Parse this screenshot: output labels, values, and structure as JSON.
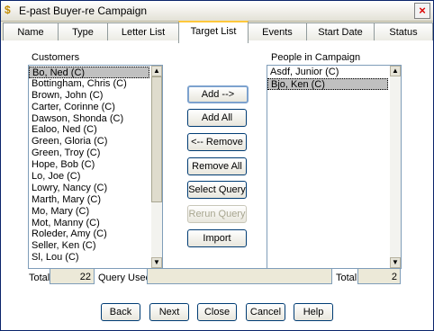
{
  "window": {
    "title": "E-past Buyer-re Campaign",
    "close_glyph": "×",
    "icon_glyph": "$"
  },
  "tabs": [
    "Name",
    "Type",
    "Letter List",
    "Target List",
    "Events",
    "Start Date",
    "Status"
  ],
  "customers": {
    "label": "Customers",
    "items": [
      "Bo, Ned (C)",
      "Bottingham, Chris (C)",
      "Brown, John (C)",
      "Carter, Corinne (C)",
      "Dawson, Shonda (C)",
      "Ealoo, Ned (C)",
      "Green, Gloria (C)",
      "Green, Troy (C)",
      "Hope, Bob (C)",
      "Lo, Joe (C)",
      "Lowry, Nancy (C)",
      "Marth, Mary (C)",
      "Mo, Mary (C)",
      "Mot, Manny (C)",
      "Roleder, Amy (C)",
      "Seller, Ken (C)",
      "Sl, Lou (C)"
    ],
    "total_label": "Total",
    "total_value": "22"
  },
  "campaign": {
    "label": "People in Campaign",
    "items": [
      "Asdf, Junior (C)",
      "Bjo, Ken (C)"
    ],
    "total_label": "Total",
    "total_value": "2"
  },
  "query": {
    "label": "Query Used",
    "value": ""
  },
  "mid_buttons": {
    "add": "Add -->",
    "add_all": "Add All",
    "remove": "<-- Remove",
    "remove_all": "Remove All",
    "select_query": "Select Query",
    "rerun_query": "Rerun Query",
    "import": "Import"
  },
  "bottom_buttons": {
    "back": "Back",
    "next": "Next",
    "close": "Close",
    "cancel": "Cancel",
    "help": "Help"
  }
}
